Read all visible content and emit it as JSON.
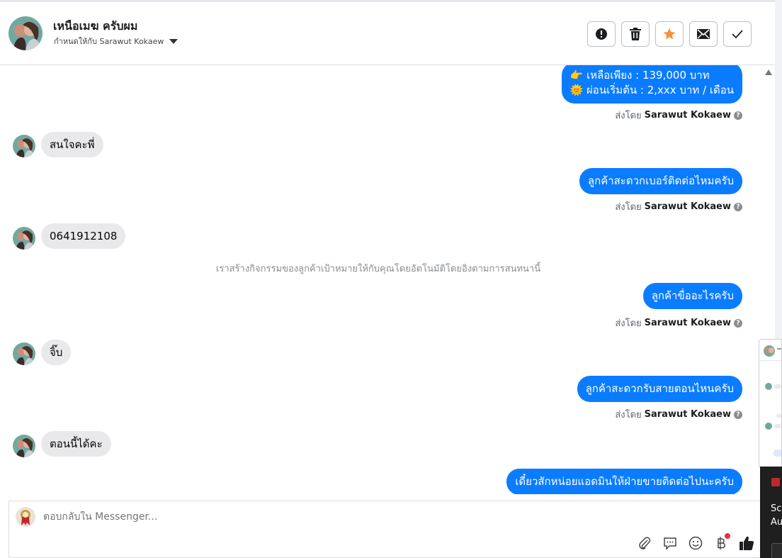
{
  "header": {
    "contact_name": "เหนือเมฆ ครับผม",
    "assigned_to": "กำหนดให้กับ Sarawut Kokaew",
    "actions": [
      "alert-icon",
      "trash-icon",
      "star-icon",
      "mail-icon",
      "check-icon"
    ],
    "star_color": "#f7923b"
  },
  "messages": {
    "m1_line1": "👉 เหลือเพียง : 139,000 บาท",
    "m1_line2": "🌞 ผ่อนเริ่มต้น : 2,xxx บาท / เดือน",
    "sent_by_prefix": "ส่งโดย",
    "sender": "Sarawut Kokaew",
    "in1": "สนใจคะพี่",
    "out2": "ลูกค้าสะดวกเบอร์ติดต่อไหมครับ",
    "in2": "0641912108",
    "system_note": "เราสร้างกิจกรรมของลูกค้าเป้าหมายให้กับคุณโดยอัตโนมัติโดยอิงตามการสนทนานี้",
    "out3": "ลูกค้าขื่ออะไรครับ",
    "in3": "จิ๊บ",
    "out4": "ลูกค้าสะดวกรับสายตอนไหนครับ",
    "in4": "ตอนนี้ได้คะ",
    "out5": "เดี๋ยวสักหน่อยแอดมินให้ฝ่ายขายติดต่อไปนะครับ"
  },
  "composer": {
    "placeholder": "ตอบกลับใน Messenger...",
    "tools": [
      "attach-icon",
      "saved-reply-icon",
      "emoji-icon",
      "baht-icon",
      "like-icon"
    ]
  },
  "toast": {
    "line1": "Scr",
    "line2": "Au"
  },
  "colors": {
    "outgoing_bubble": "#0a7cff",
    "incoming_bubble": "#e9e9eb",
    "notification_dot": "#f02849"
  }
}
